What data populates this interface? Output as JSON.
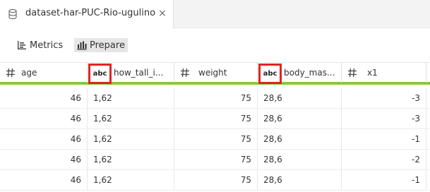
{
  "tab": {
    "title": "dataset-har-PUC-Rio-ugulino",
    "icon": "database-icon",
    "close_glyph": "×"
  },
  "toolbar": {
    "metrics_label": "Metrics",
    "prepare_label": "Prepare",
    "active": "Prepare"
  },
  "table": {
    "columns": [
      {
        "name": "age",
        "type_label": "#",
        "type": "number"
      },
      {
        "name": "how_tall_i...",
        "type_label": "abc",
        "type": "text"
      },
      {
        "name": "weight",
        "type_label": "#",
        "type": "number"
      },
      {
        "name": "body_mas...",
        "type_label": "abc",
        "type": "text"
      },
      {
        "name": "x1",
        "type_label": "#",
        "type": "number"
      }
    ],
    "rows": [
      [
        "46",
        "1,62",
        "75",
        "28,6",
        "-3"
      ],
      [
        "46",
        "1,62",
        "75",
        "28,6",
        "-3"
      ],
      [
        "46",
        "1,62",
        "75",
        "28,6",
        "-1"
      ],
      [
        "46",
        "1,62",
        "75",
        "28,6",
        "-2"
      ],
      [
        "46",
        "1,62",
        "75",
        "28,6",
        "-1"
      ]
    ]
  },
  "colors": {
    "header_underline": "#8cc63f",
    "type_highlight": "#e02424",
    "prepare_bg": "#e6e6e6"
  }
}
